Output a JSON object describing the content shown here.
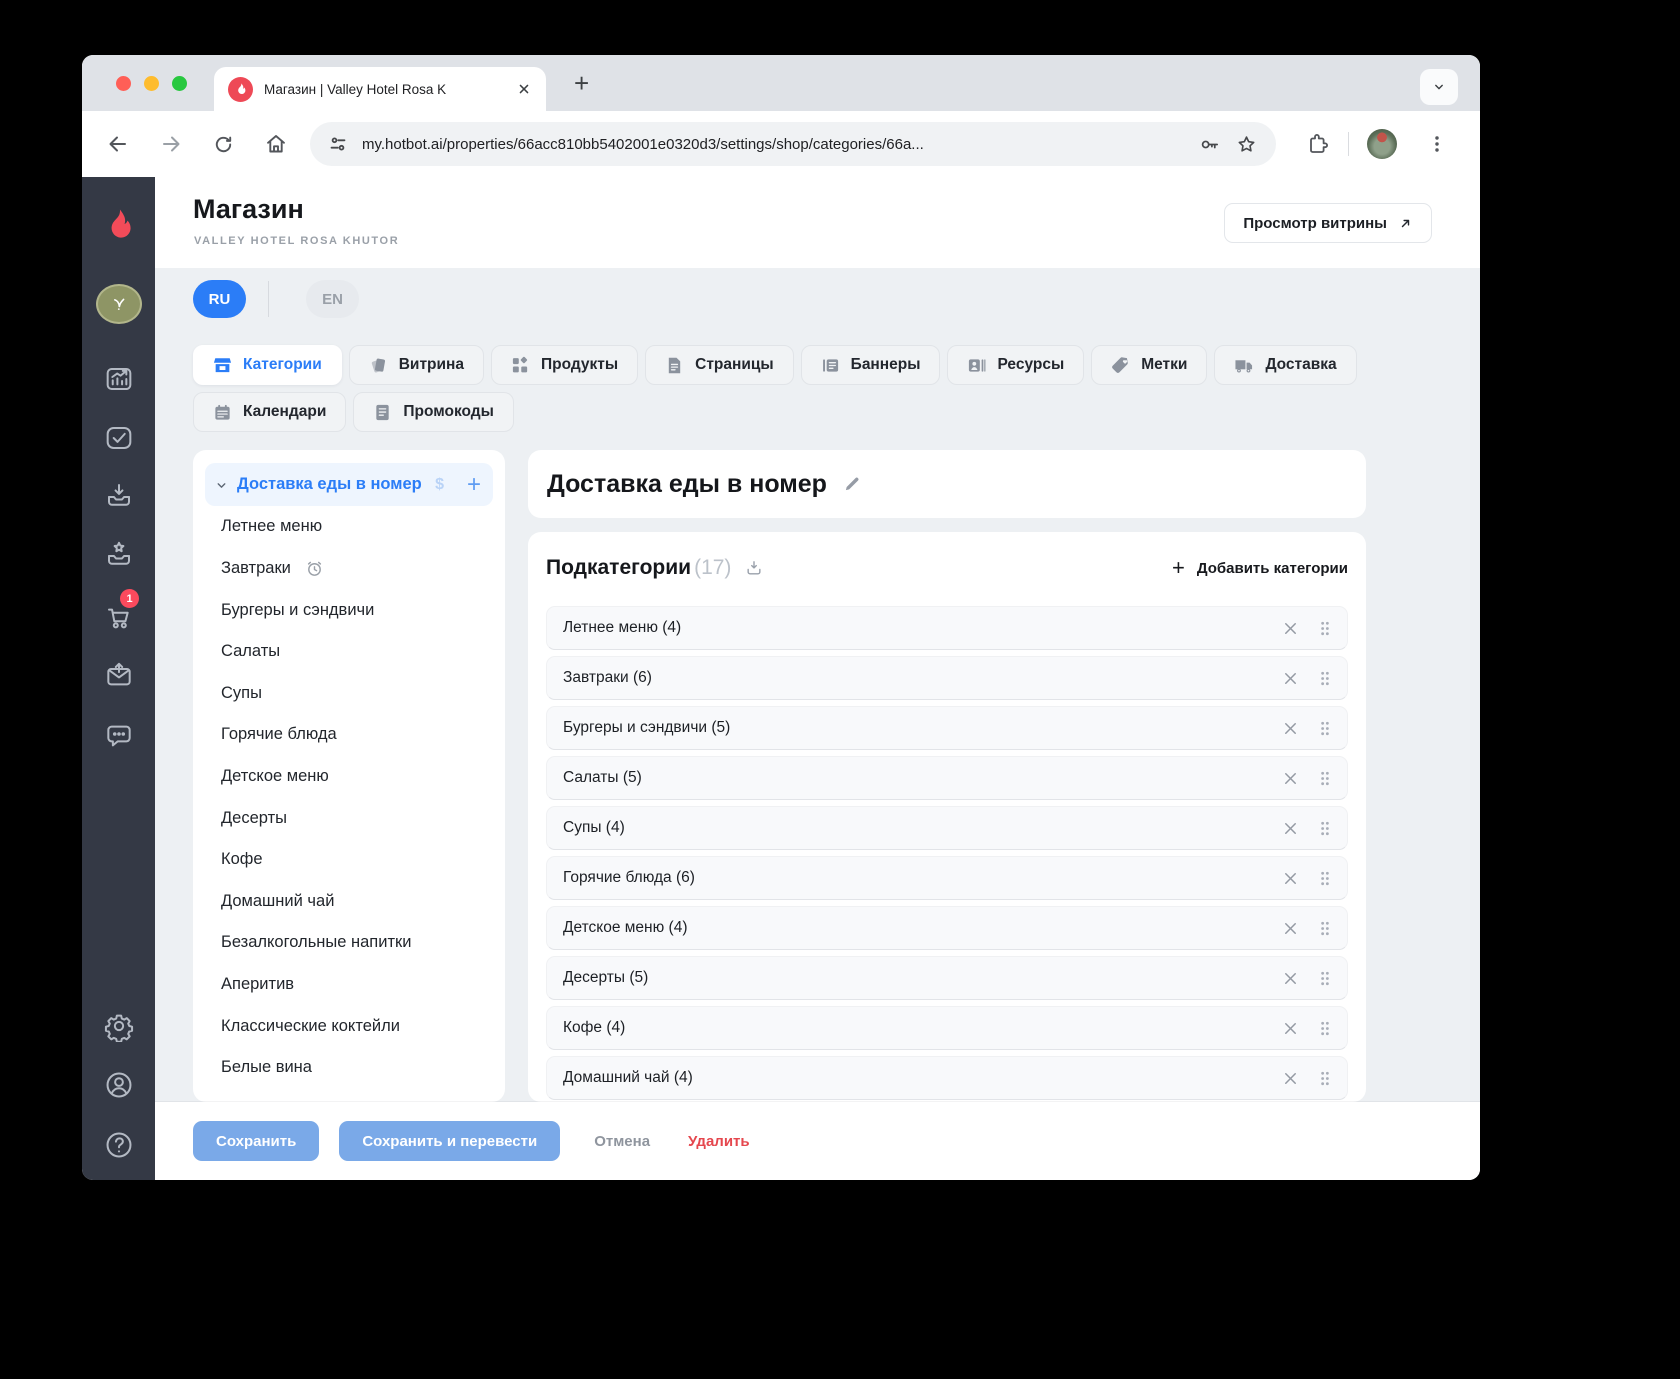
{
  "browser": {
    "tab_title": "Магазин | Valley Hotel Rosa K",
    "new_tab_label": "+",
    "url": "my.hotbot.ai/properties/66acc810bb5402001e0320d3/settings/shop/categories/66a..."
  },
  "app_sidebar": {
    "cart_badge": "1",
    "icons": [
      "flame-logo",
      "hotel-avatar",
      "analytics-icon",
      "tasks-icon",
      "inbox-download-icon",
      "inbox-star-icon",
      "cart-icon",
      "envelope-up-icon",
      "chat-icon",
      "gear-icon",
      "account-icon",
      "help-icon"
    ]
  },
  "header": {
    "title": "Магазин",
    "subtitle": "VALLEY HOTEL ROSA KHUTOR",
    "preview_button": "Просмотр витрины"
  },
  "languages": {
    "ru": "RU",
    "en": "EN"
  },
  "nav_tabs": [
    {
      "label": "Категории",
      "icon": "storefront-icon",
      "active": true
    },
    {
      "label": "Витрина",
      "icon": "showcase-icon"
    },
    {
      "label": "Продукты",
      "icon": "products-icon"
    },
    {
      "label": "Страницы",
      "icon": "pages-icon"
    },
    {
      "label": "Баннеры",
      "icon": "banners-icon"
    },
    {
      "label": "Ресурсы",
      "icon": "resources-icon"
    },
    {
      "label": "Метки",
      "icon": "tag-icon"
    },
    {
      "label": "Доставка",
      "icon": "truck-icon"
    },
    {
      "label": "Календари",
      "icon": "calendar-icon"
    },
    {
      "label": "Промокоды",
      "icon": "promocode-icon"
    }
  ],
  "category_tree": {
    "parent": "Доставка еды в номер",
    "dollar": "$",
    "plus": "+",
    "items": [
      "Летнее меню",
      "Завтраки",
      "Бургеры и сэндвичи",
      "Салаты",
      "Супы",
      "Горячие блюда",
      "Детское меню",
      "Десерты",
      "Кофе",
      "Домашний чай",
      "Безалкогольные напитки",
      "Аперитив",
      "Классические коктейли",
      "Белые вина"
    ]
  },
  "detail": {
    "title": "Доставка еды в номер",
    "subcategories_label": "Подкатегории",
    "subcategories_count": "(17)",
    "add_plus": "+",
    "add_button": "Добавить категории",
    "rows": [
      "Летнее меню (4)",
      "Завтраки (6)",
      "Бургеры и сэндвичи (5)",
      "Салаты (5)",
      "Супы (4)",
      "Горячие блюда (6)",
      "Детское меню (4)",
      "Десерты (5)",
      "Кофе (4)",
      "Домашний чай (4)"
    ]
  },
  "footer": {
    "save": "Сохранить",
    "save_translate": "Сохранить и перевести",
    "cancel": "Отмена",
    "delete": "Удалить"
  },
  "colors": {
    "accent_blue": "#2b7df7",
    "save_button_blue": "#7aa9e8",
    "delete_red": "#e5474e",
    "sidebar_dark": "#343945",
    "badge_red": "#fb4a5d",
    "brand_flame": "#ee4956",
    "hotel_olive": "#8e9565",
    "selected_category_bg": "#eef5fe"
  }
}
